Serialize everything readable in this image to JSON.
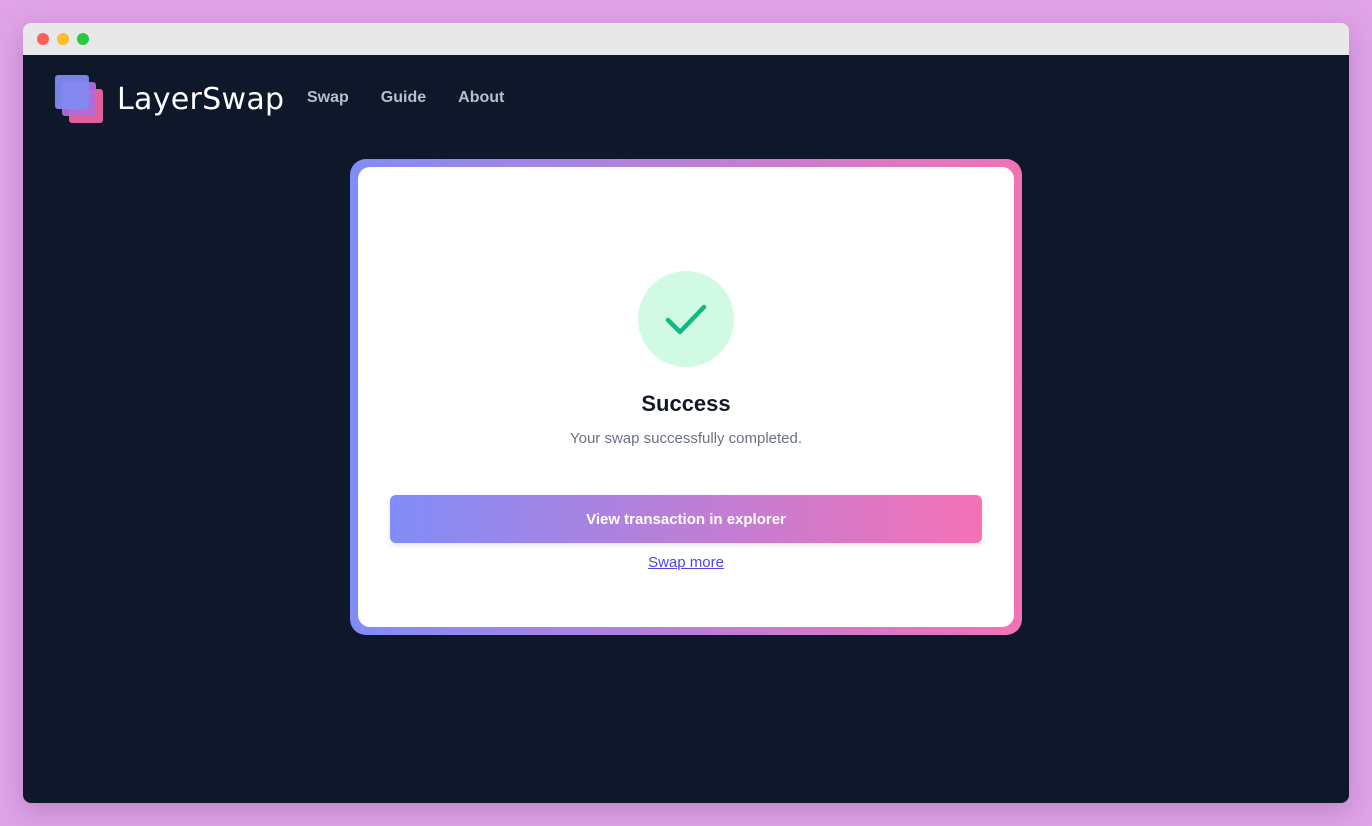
{
  "app": {
    "brand": "LayerSwap",
    "brand_colors": {
      "indigo": "#818cf8",
      "pink": "#f472b6",
      "background": "#0f172a"
    }
  },
  "nav": {
    "items": [
      {
        "label": "Swap"
      },
      {
        "label": "Guide"
      },
      {
        "label": "About"
      }
    ]
  },
  "result": {
    "icon": "check-icon",
    "title": "Success",
    "message": "Your swap successfully completed.",
    "primary_action": "View transaction in explorer",
    "secondary_action": "Swap more",
    "status_color": "#10b981"
  }
}
